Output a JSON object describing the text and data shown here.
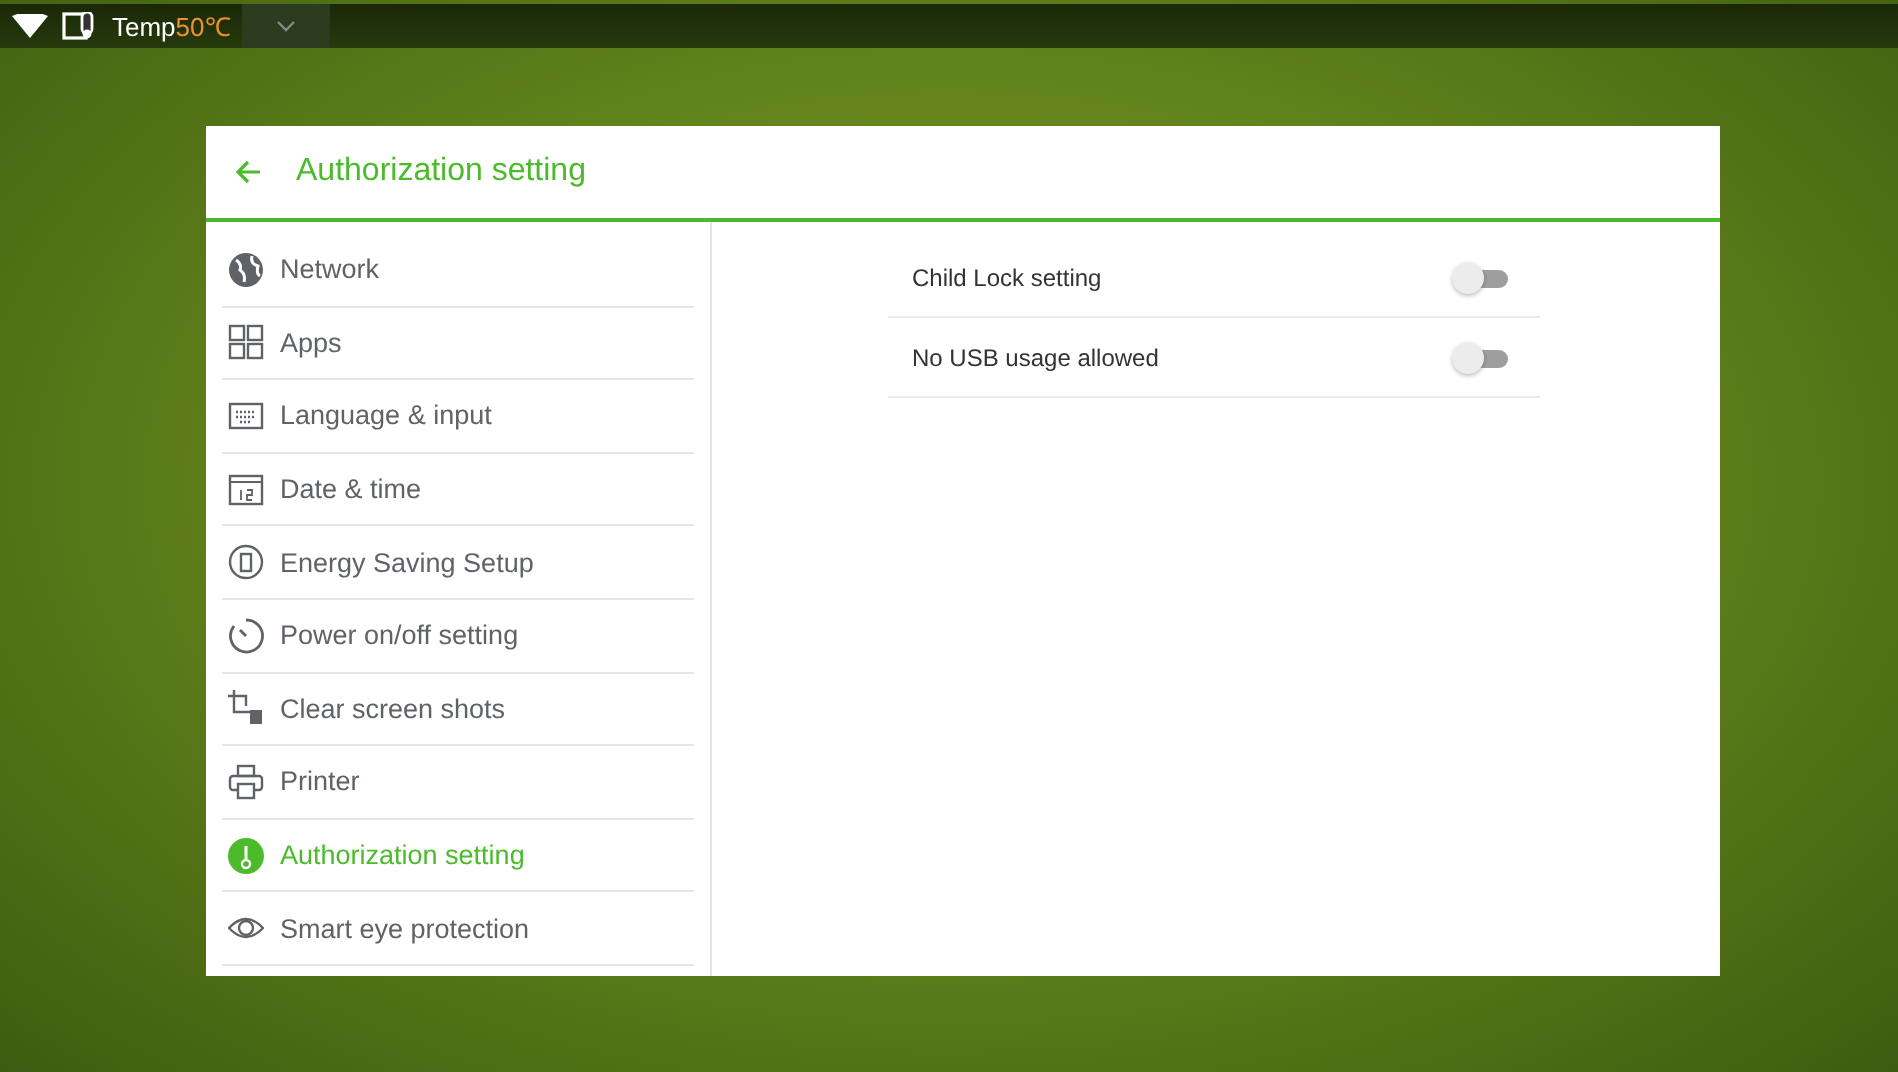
{
  "status_bar": {
    "temp_label": "Temp",
    "temp_value": "50℃"
  },
  "header": {
    "title": "Authorization setting"
  },
  "sidebar": {
    "items": [
      {
        "label": "Network",
        "selected": false
      },
      {
        "label": "Apps",
        "selected": false
      },
      {
        "label": "Language & input",
        "selected": false
      },
      {
        "label": "Date & time",
        "selected": false
      },
      {
        "label": "Energy Saving Setup",
        "selected": false
      },
      {
        "label": "Power on/off setting",
        "selected": false
      },
      {
        "label": "Clear screen shots",
        "selected": false
      },
      {
        "label": "Printer",
        "selected": false
      },
      {
        "label": "Authorization setting",
        "selected": true
      },
      {
        "label": "Smart eye protection",
        "selected": false
      }
    ]
  },
  "settings": [
    {
      "label": "Child Lock setting",
      "on": false
    },
    {
      "label": "No USB usage allowed",
      "on": false
    }
  ]
}
